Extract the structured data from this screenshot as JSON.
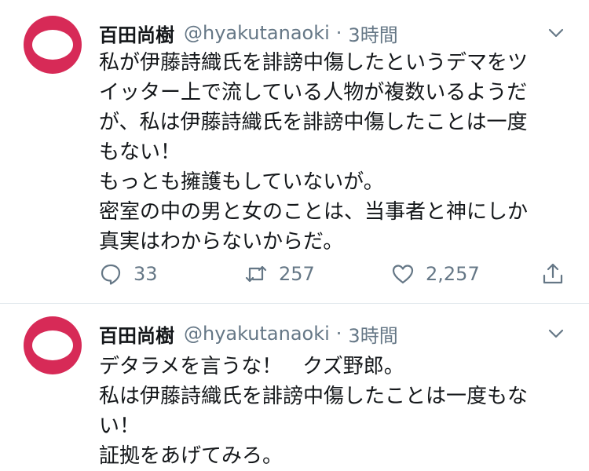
{
  "tweets": [
    {
      "user_name": "百田尚樹",
      "handle": "@hyakutanaoki",
      "separator": "·",
      "time": "3時間",
      "lines": [
        "私が伊藤詩織氏を誹謗中傷したというデマをツ",
        "イッター上で流している人物が複数いるようだ",
        "が、私は伊藤詩織氏を誹謗中傷したことは一度",
        "もない！",
        "もっとも擁護もしていないが。",
        "密室の中の男と女のことは、当事者と神にしか",
        "真実はわからないからだ。"
      ],
      "reply_count": "33",
      "retweet_count": "257",
      "like_count": "2,257"
    },
    {
      "user_name": "百田尚樹",
      "handle": "@hyakutanaoki",
      "separator": "·",
      "time": "3時間",
      "lines": [
        "デタラメを言うな！　クズ野郎。",
        "私は伊藤詩織氏を誹謗中傷したことは一度もな",
        "い！",
        "証拠をあげてみろ。"
      ]
    }
  ],
  "icons": {
    "avatar_color": "#d72a57",
    "reply": "reply-icon",
    "retweet": "retweet-icon",
    "like": "heart-icon",
    "share": "share-icon",
    "menu": "chevron-down-icon"
  }
}
